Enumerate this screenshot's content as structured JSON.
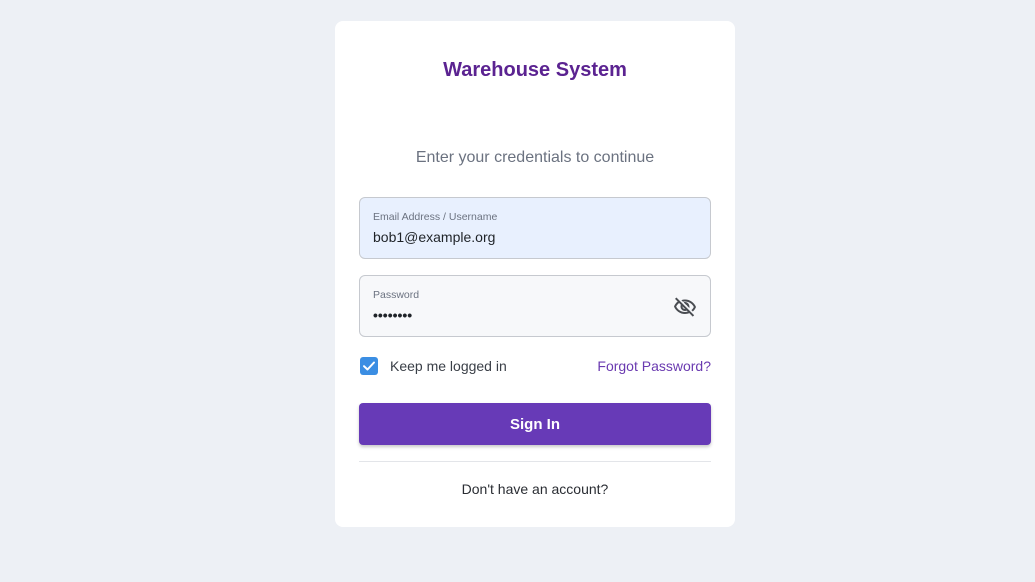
{
  "login": {
    "title": "Warehouse System",
    "subtitle": "Enter your credentials to continue",
    "email": {
      "label": "Email Address / Username",
      "value": "bob1@example.org"
    },
    "password": {
      "label": "Password",
      "masked_value": "••••••••",
      "toggle_icon": "eye-off-icon"
    },
    "remember": {
      "label": "Keep me logged in",
      "checked": true
    },
    "forgot_link": "Forgot Password?",
    "signin_label": "Sign In",
    "no_account_link": "Don't have an account?"
  },
  "colors": {
    "background": "#edf0f5",
    "title": "#5b2391",
    "primary_button": "#673ab7",
    "checkbox": "#3b8ee3",
    "link": "#6a3ab0",
    "email_field_bg": "#e8f0fe"
  }
}
